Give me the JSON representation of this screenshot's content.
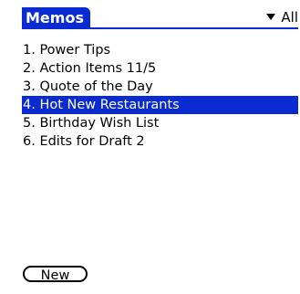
{
  "header": {
    "title": "Memos",
    "category": "All",
    "category_icon": "dropdown-triangle-icon"
  },
  "memos": [
    {
      "label": "1. Power Tips",
      "selected": false
    },
    {
      "label": "2. Action Items 11/5",
      "selected": false
    },
    {
      "label": "3. Quote of the Day",
      "selected": false
    },
    {
      "label": "4. Hot New Restaurants",
      "selected": true
    },
    {
      "label": "5. Birthday Wish List",
      "selected": false
    },
    {
      "label": "6. Edits for Draft 2",
      "selected": false
    }
  ],
  "buttons": {
    "new_label": "New"
  },
  "colors": {
    "accent": "#0a2bd2",
    "background": "#ffffff",
    "text": "#000000",
    "selected_text": "#ffffff"
  }
}
